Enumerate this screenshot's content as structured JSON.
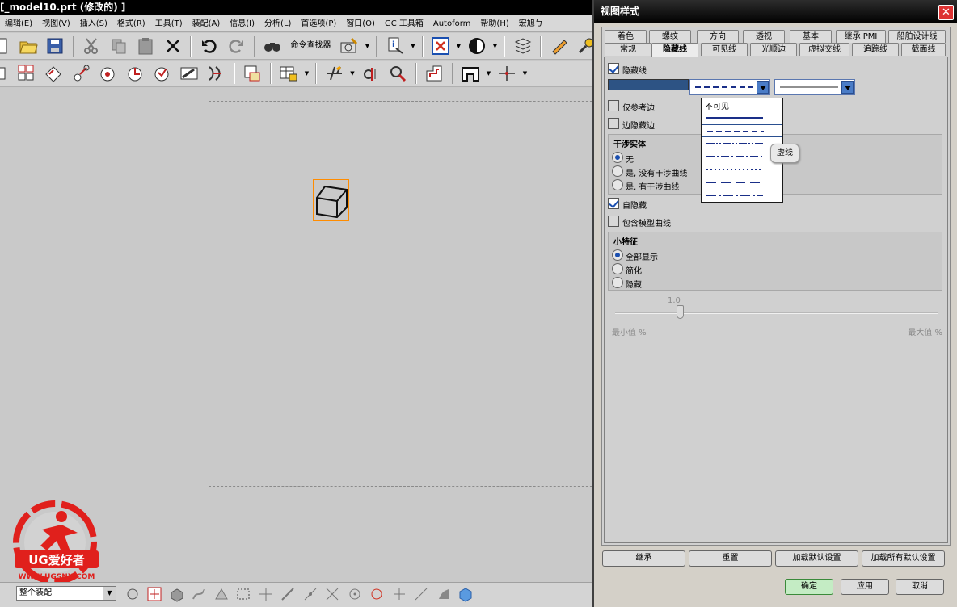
{
  "app": {
    "title": "[_model10.prt (修改的) ]",
    "menu": [
      "编辑(E)",
      "视图(V)",
      "插入(S)",
      "格式(R)",
      "工具(T)",
      "装配(A)",
      "信息(I)",
      "分析(L)",
      "首选项(P)",
      "窗口(O)",
      "GC 工具箱",
      "Autoform",
      "帮助(H)",
      "宏旭ㄅ"
    ],
    "toolbar": {
      "command_finder": "命令查找器"
    },
    "status": {
      "selection_filter": "整个装配"
    },
    "logo": {
      "brand": "UG爱好者",
      "url": "WWW.UGSNX.COM"
    }
  },
  "dialog": {
    "title": "视图样式",
    "tabs_row1": [
      "着色",
      "螺纹",
      "方向",
      "透视",
      "基本",
      "继承 PMI",
      "船舶设计线"
    ],
    "tabs_row2": [
      "常规",
      "隐藏线",
      "可见线",
      "光顺边",
      "虚拟交线",
      "追踪线",
      "截面线"
    ],
    "active_tab": "隐藏线",
    "hidden_lines": {
      "label": "隐藏线",
      "checked": true,
      "color": "#2d5384"
    },
    "line_style_options": [
      "不可见",
      "实线",
      "虚线",
      "双点划线",
      "中心线",
      "点线",
      "长划双短划线",
      "点划线"
    ],
    "line_style_first": "不可见",
    "line_style_tooltip": "虚线",
    "ref_edges_only": {
      "label": "仅参考边",
      "checked": false
    },
    "edges_hidden_by_edges": {
      "label": "边隐藏边",
      "checked": false
    },
    "interference": {
      "title": "干涉实体",
      "options": [
        "无",
        "是, 没有干涉曲线",
        "是, 有干涉曲线"
      ],
      "selected": 0
    },
    "self_hidden": {
      "label": "自隐藏",
      "checked": true
    },
    "include_model_curves": {
      "label": "包含模型曲线",
      "checked": false
    },
    "small_features": {
      "title": "小特征",
      "options": [
        "全部显示",
        "简化",
        "隐藏"
      ],
      "selected": 0
    },
    "slider": {
      "value": "1.0",
      "min_label": "最小值 %",
      "max_label": "最大值 %",
      "fraction": 0.2
    },
    "buttons": {
      "inherit": "继承",
      "reset": "重置",
      "load_default": "加载默认设置",
      "load_all_default": "加载所有默认设置"
    },
    "footer": {
      "ok": "确定",
      "apply": "应用",
      "cancel": "取消"
    }
  }
}
